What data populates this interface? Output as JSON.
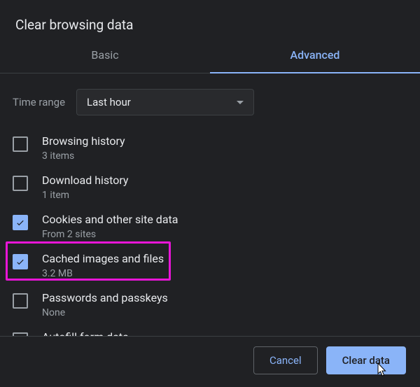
{
  "title": "Clear browsing data",
  "tabs": [
    {
      "label": "Basic",
      "active": false
    },
    {
      "label": "Advanced",
      "active": true
    }
  ],
  "timeRange": {
    "label": "Time range",
    "value": "Last hour"
  },
  "options": [
    {
      "label": "Browsing history",
      "sub": "3 items",
      "checked": false
    },
    {
      "label": "Download history",
      "sub": "1 item",
      "checked": false
    },
    {
      "label": "Cookies and other site data",
      "sub": "From 2 sites",
      "checked": true
    },
    {
      "label": "Cached images and files",
      "sub": "3.2 MB",
      "checked": true,
      "highlighted": true
    },
    {
      "label": "Passwords and passkeys",
      "sub": "None",
      "checked": false
    },
    {
      "label": "Autofill form data",
      "sub": "",
      "checked": false
    }
  ],
  "buttons": {
    "cancel": "Cancel",
    "clear": "Clear data"
  },
  "colors": {
    "accent": "#8ab4f8",
    "highlight": "#e815d7",
    "bg": "#202124"
  }
}
